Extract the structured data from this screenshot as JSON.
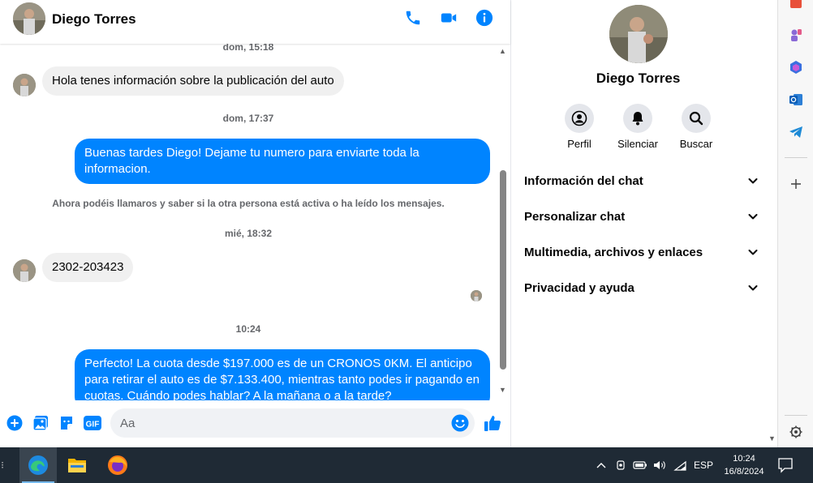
{
  "contact": {
    "name": "Diego Torres"
  },
  "messages": [
    {
      "kind": "time",
      "text": "dom, 15:18"
    },
    {
      "kind": "in",
      "text": "Hola tenes información sobre la publicación del auto"
    },
    {
      "kind": "time",
      "text": "dom, 17:37"
    },
    {
      "kind": "out",
      "text": "Buenas tardes Diego! Dejame tu numero para enviarte toda la informacion."
    },
    {
      "kind": "system",
      "text": "Ahora podéis llamaros y saber si la otra persona está activa o ha leído los mensajes."
    },
    {
      "kind": "time",
      "text": "mié, 18:32"
    },
    {
      "kind": "in",
      "text": "2302-203423"
    },
    {
      "kind": "time",
      "text": "10:24"
    },
    {
      "kind": "out",
      "text": "Perfecto! La cuota desde $197.000 es de un CRONOS 0KM. El anticipo para retirar el auto es de $7.133.400, mientras tanto podes ir pagando en cuotas. Cuándo podes hablar? A la mañana o a la tarde?"
    }
  ],
  "composer": {
    "placeholder": "Aa"
  },
  "info_panel": {
    "actions": [
      {
        "label": "Perfil",
        "icon": "profile-icon"
      },
      {
        "label": "Silenciar",
        "icon": "bell-icon"
      },
      {
        "label": "Buscar",
        "icon": "search-icon"
      }
    ],
    "sections": [
      "Información del chat",
      "Personalizar chat",
      "Multimedia, archivos y enlaces",
      "Privacidad y ayuda"
    ]
  },
  "taskbar": {
    "apps": [
      "edge-icon",
      "file-explorer-icon",
      "firefox-icon"
    ],
    "language": "ESP",
    "time": "10:24",
    "date": "16/8/2024"
  },
  "colors": {
    "messenger_blue": "#0084ff",
    "incoming_bubble": "#f0f0f0",
    "taskbar": "#1f2a35"
  }
}
